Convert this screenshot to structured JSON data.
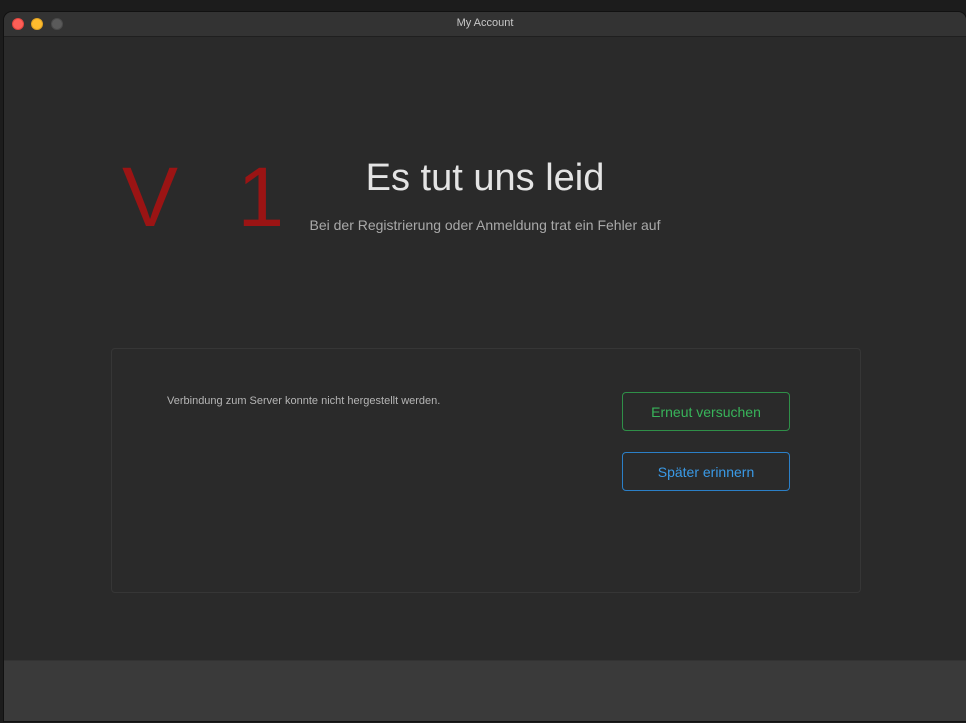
{
  "window": {
    "title": "My Account"
  },
  "watermark": {
    "text": "V 1",
    "color": "#9b1414"
  },
  "main": {
    "headline": "Es tut uns leid",
    "subline": "Bei der Registrierung oder Anmeldung trat ein Fehler auf"
  },
  "panel": {
    "error_message": "Verbindung zum Server konnte nicht hergestellt werden.",
    "retry_label": "Erneut versuchen",
    "later_label": "Später erinnern"
  },
  "colors": {
    "retry_accent": "#38b45a",
    "later_accent": "#3a9ae6",
    "background": "#2a2a2a"
  }
}
